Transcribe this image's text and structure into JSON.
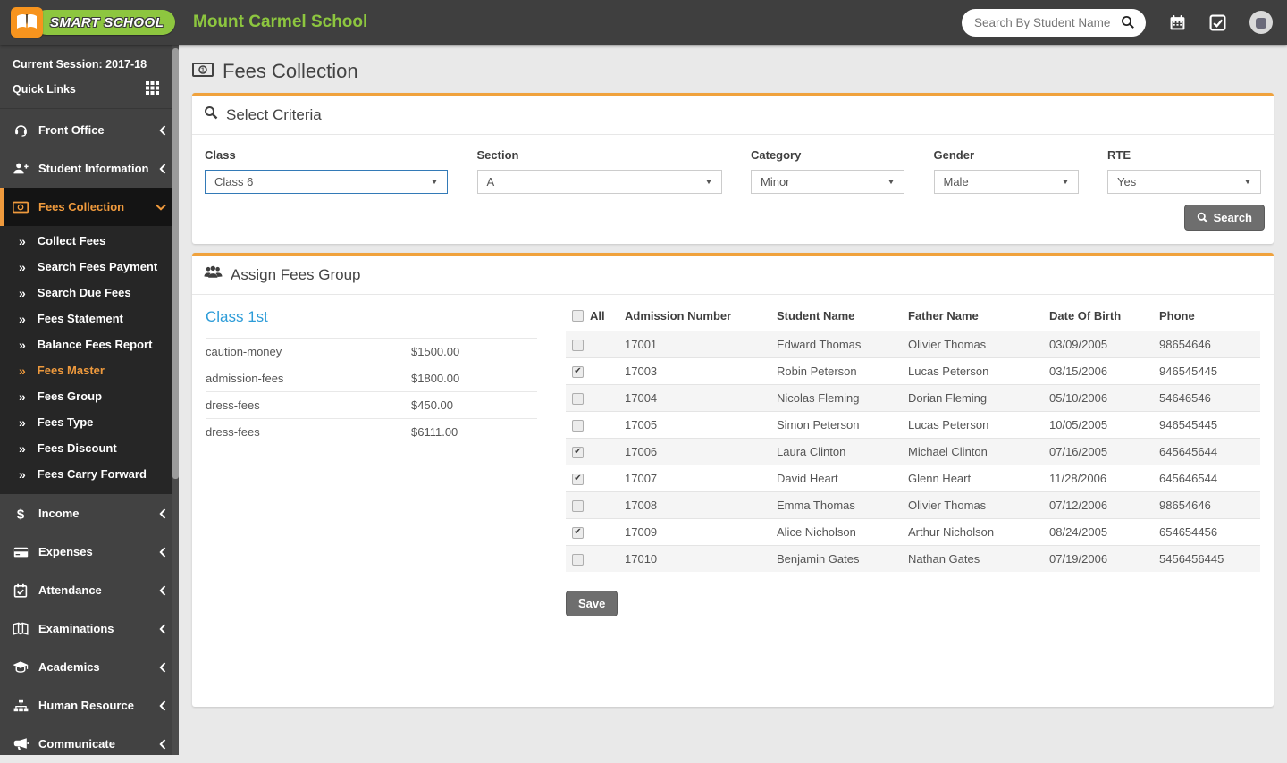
{
  "colors": {
    "accent_orange": "#f0a23c",
    "brand_green": "#8dc63f",
    "sidebar_active_orange": "#ef9a3d",
    "link_blue": "#2d9cd8",
    "navbar_bg": "#3f3f3f",
    "sidebar_bg": "#424242",
    "button_gray": "#6e6e6e"
  },
  "navbar": {
    "brand": "SMART SCHOOL",
    "school_name": "Mount Carmel School",
    "search_placeholder": "Search By Student Name",
    "icons": [
      "search-icon",
      "calendar-icon",
      "tasks-icon",
      "avatar"
    ]
  },
  "sidebar": {
    "session_label": "Current Session: 2017-18",
    "quick_links_label": "Quick Links",
    "menu": [
      {
        "label": "Front Office",
        "icon": "headset",
        "chevron": "left"
      },
      {
        "label": "Student Information",
        "icon": "user-plus",
        "chevron": "left"
      },
      {
        "label": "Fees Collection",
        "icon": "money",
        "chevron": "down",
        "active": true,
        "expanded": true,
        "submenu": [
          {
            "label": "Collect Fees"
          },
          {
            "label": "Search Fees Payment"
          },
          {
            "label": "Search Due Fees"
          },
          {
            "label": "Fees Statement"
          },
          {
            "label": "Balance Fees Report"
          },
          {
            "label": "Fees Master",
            "active": true
          },
          {
            "label": "Fees Group"
          },
          {
            "label": "Fees Type"
          },
          {
            "label": "Fees Discount"
          },
          {
            "label": "Fees Carry Forward"
          }
        ]
      },
      {
        "label": "Income",
        "icon": "dollar",
        "chevron": "left"
      },
      {
        "label": "Expenses",
        "icon": "credit-card",
        "chevron": "left"
      },
      {
        "label": "Attendance",
        "icon": "calendar-check",
        "chevron": "left"
      },
      {
        "label": "Examinations",
        "icon": "book-open",
        "chevron": "left"
      },
      {
        "label": "Academics",
        "icon": "graduation-cap",
        "chevron": "left"
      },
      {
        "label": "Human Resource",
        "icon": "sitemap",
        "chevron": "left"
      },
      {
        "label": "Communicate",
        "icon": "bullhorn",
        "chevron": "left"
      }
    ]
  },
  "page": {
    "title": "Fees Collection"
  },
  "criteria": {
    "title": "Select Criteria",
    "fields": [
      {
        "label": "Class",
        "value": "Class 6",
        "focused": true
      },
      {
        "label": "Section",
        "value": "A"
      },
      {
        "label": "Category",
        "value": "Minor"
      },
      {
        "label": "Gender",
        "value": "Male"
      },
      {
        "label": "RTE",
        "value": "Yes"
      }
    ],
    "search_button": "Search"
  },
  "assign": {
    "title": "Assign Fees Group",
    "fees_group": {
      "name": "Class 1st",
      "items": [
        {
          "name": "caution-money",
          "amount": "$1500.00"
        },
        {
          "name": "admission-fees",
          "amount": "$1800.00"
        },
        {
          "name": "dress-fees",
          "amount": "$450.00"
        },
        {
          "name": "dress-fees",
          "amount": "$6111.00"
        }
      ]
    },
    "table": {
      "select_all_label": "All",
      "columns": [
        "Admission Number",
        "Student Name",
        "Father Name",
        "Date Of Birth",
        "Phone"
      ],
      "rows": [
        {
          "checked": false,
          "admission": "17001",
          "student": "Edward Thomas",
          "father": "Olivier Thomas",
          "dob": "03/09/2005",
          "phone": "98654646"
        },
        {
          "checked": true,
          "admission": "17003",
          "student": "Robin Peterson",
          "father": "Lucas Peterson",
          "dob": "03/15/2006",
          "phone": "946545445"
        },
        {
          "checked": false,
          "admission": "17004",
          "student": "Nicolas Fleming",
          "father": "Dorian Fleming",
          "dob": "05/10/2006",
          "phone": "54646546"
        },
        {
          "checked": false,
          "admission": "17005",
          "student": "Simon Peterson",
          "father": "Lucas Peterson",
          "dob": "10/05/2005",
          "phone": "946545445"
        },
        {
          "checked": true,
          "admission": "17006",
          "student": "Laura Clinton",
          "father": "Michael Clinton",
          "dob": "07/16/2005",
          "phone": "645645644"
        },
        {
          "checked": true,
          "admission": "17007",
          "student": "David Heart",
          "father": "Glenn Heart",
          "dob": "11/28/2006",
          "phone": "645646544"
        },
        {
          "checked": false,
          "admission": "17008",
          "student": "Emma Thomas",
          "father": "Olivier Thomas",
          "dob": "07/12/2006",
          "phone": "98654646"
        },
        {
          "checked": true,
          "admission": "17009",
          "student": "Alice Nicholson",
          "father": "Arthur Nicholson",
          "dob": "08/24/2005",
          "phone": "654654456"
        },
        {
          "checked": false,
          "admission": "17010",
          "student": "Benjamin Gates",
          "father": "Nathan Gates",
          "dob": "07/19/2006",
          "phone": "5456456445"
        }
      ]
    },
    "save_button": "Save"
  }
}
